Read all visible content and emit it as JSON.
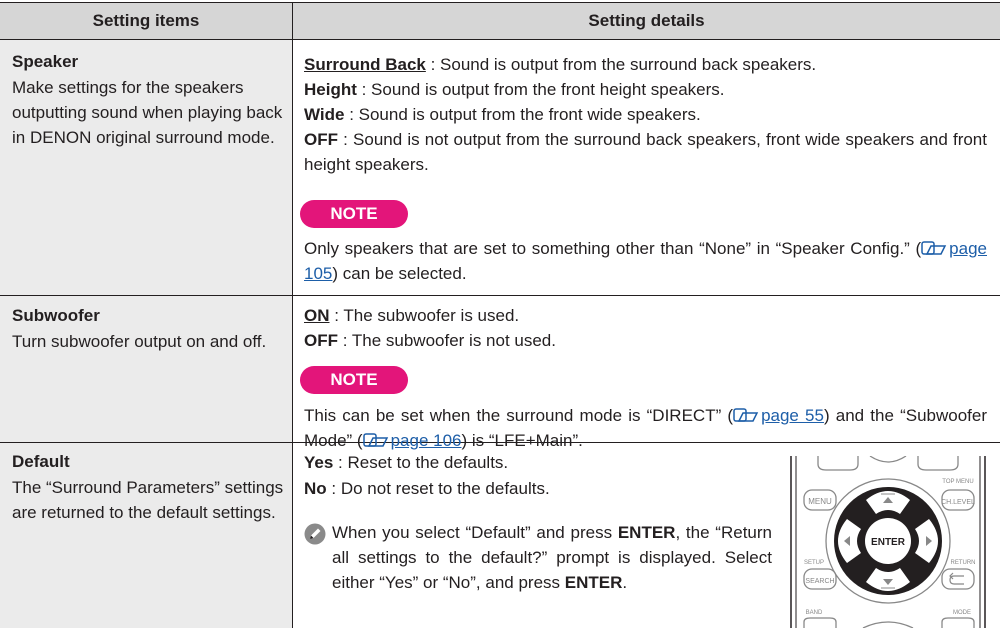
{
  "table": {
    "header_items": "Setting items",
    "header_details": "Setting details"
  },
  "rows": {
    "speaker": {
      "title": "Speaker",
      "description": "Make settings for the speakers outputting sound when playing back in DENON original surround mode.",
      "opt1_label": "Surround Back",
      "opt1_text": " : Sound is output from the surround back speakers.",
      "opt2_label": "Height",
      "opt2_text": " : Sound is output from the front height speakers.",
      "opt3_label": "Wide",
      "opt3_text": " : Sound is output from the front wide speakers.",
      "opt4_label": "OFF",
      "opt4_text": " : Sound is not output from the surround back speakers, front wide speakers and front height speakers.",
      "note_label": "NOTE",
      "note_text_a": "Only speakers that are set to something other than “None” in “Speaker Config.” (",
      "note_link": "page 105",
      "note_text_b": ") can be selected."
    },
    "subwoofer": {
      "title": "Subwoofer",
      "description": "Turn subwoofer output on and off.",
      "opt1_label": "ON",
      "opt1_text": " : The subwoofer is used.",
      "opt2_label": "OFF",
      "opt2_text": " : The subwoofer is not used.",
      "note_label": "NOTE",
      "note_text_a": "This can be set when the surround mode is “DIRECT” (",
      "note_link1": "page 55",
      "note_text_b": ") and the “Subwoofer Mode” (",
      "note_link2": "page 106",
      "note_text_c": ") is “LFE+Main”."
    },
    "default": {
      "title": "Default",
      "description": "The “Surround Parameters” settings are returned to the default settings.",
      "opt1_label": "Yes",
      "opt1_text": " : Reset to the defaults.",
      "opt2_label": "No",
      "opt2_text": " : Do not reset to the defaults.",
      "note_a": "When you select “Default” and press ",
      "note_enter1": "ENTER",
      "note_b": ", the “Return all settings to the default?” prompt is displayed. Select either “Yes” or “No”, and press ",
      "note_enter2": "ENTER",
      "note_c": "."
    }
  },
  "remote": {
    "menu": "MENU",
    "top_menu": "TOP MENU",
    "ch_level": "CH.LEVEL",
    "setup": "SETUP",
    "search": "SEARCH",
    "return": "RETURN",
    "band": "BAND",
    "mode": "MODE",
    "enter": "ENTER"
  },
  "colors": {
    "note_badge": "#e3157a",
    "link": "#1d5ea8",
    "header_bg": "#d6d6d6",
    "item_bg": "#ebebeb"
  }
}
